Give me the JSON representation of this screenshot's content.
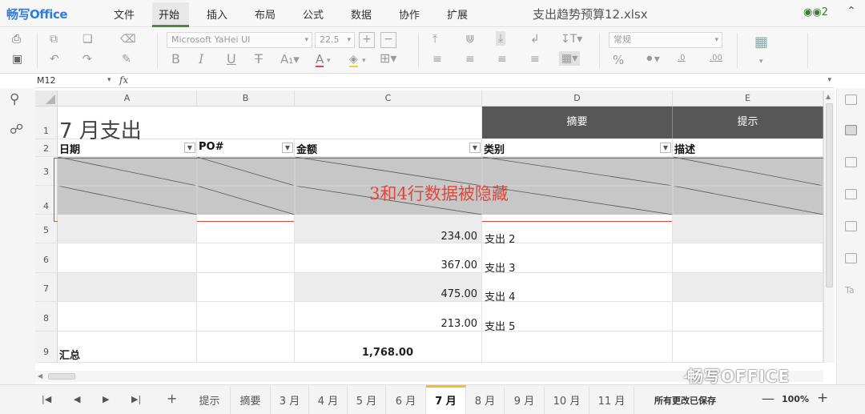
{
  "app": {
    "logo": "畅写Office",
    "menus": [
      "文件",
      "开始",
      "插入",
      "布局",
      "公式",
      "数据",
      "协作",
      "扩展"
    ],
    "active_menu": "开始",
    "doc_title": "支出趋势预算12.xlsx",
    "share_label": "2"
  },
  "toolbar": {
    "font_name": "Microsoft YaHei UI",
    "font_size": "22.5",
    "number_format": "常规",
    "percent": "%",
    "dec_inc": ".0",
    "dec_dec": ".00"
  },
  "formula": {
    "cell_ref": "M12",
    "fx": "fx"
  },
  "sheet": {
    "columns": [
      "A",
      "B",
      "C",
      "D",
      "E"
    ],
    "rows": [
      "1",
      "2",
      "3",
      "4",
      "5",
      "6",
      "7",
      "8",
      "9"
    ],
    "title": "7 月支出",
    "header_summary": "摘要",
    "header_hint": "提示",
    "col_headers": {
      "date": "日期",
      "po": "PO#",
      "amount": "金额",
      "category": "类别",
      "desc": "描述"
    },
    "hidden_note": "3和4行数据被隐藏",
    "data_rows": [
      {
        "amount": "234.00",
        "category": "支出 2"
      },
      {
        "amount": "367.00",
        "category": "支出 3"
      },
      {
        "amount": "475.00",
        "category": "支出 4"
      },
      {
        "amount": "213.00",
        "category": "支出 5"
      }
    ],
    "total_label": "汇总",
    "total_value": "1,768.00"
  },
  "tabs": [
    "提示",
    "摘要",
    "3 月",
    "4 月",
    "5 月",
    "6 月",
    "7 月",
    "8 月",
    "9 月",
    "10 月",
    "11 月"
  ],
  "active_tab": "7 月",
  "status": {
    "save_text": "所有更改已保存",
    "zoom": "100%"
  },
  "watermark": "畅写OFFICE"
}
